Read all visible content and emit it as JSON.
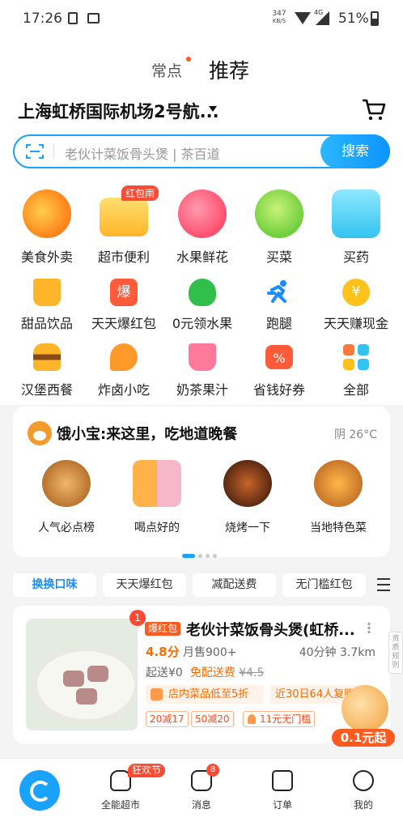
{
  "status_bar": {
    "time": "17:26",
    "speed_value": "347",
    "speed_unit": "KB/S",
    "network": "4G",
    "battery": "51%"
  },
  "header_tabs": {
    "frequent": "常点",
    "recommend": "推荐"
  },
  "location": {
    "text": "上海虹桥国际机场2号航..."
  },
  "search": {
    "placeholder": "老伙计菜饭骨头煲 | 茶百道",
    "button": "搜索"
  },
  "categories_primary": [
    {
      "label": "美食外卖",
      "icon": "food-delivery-icon"
    },
    {
      "label": "超市便利",
      "icon": "supermarket-basket-icon",
      "badge": "红包雨"
    },
    {
      "label": "水果鲜花",
      "icon": "fruit-icon"
    },
    {
      "label": "买菜",
      "icon": "vegetables-icon"
    },
    {
      "label": "买药",
      "icon": "medicine-box-icon"
    }
  ],
  "categories_secondary": [
    {
      "label": "甜品饮品",
      "icon": "drink-cup-icon"
    },
    {
      "label": "天天爆红包",
      "icon": "red-packet-icon",
      "glyph": "爆"
    },
    {
      "label": "0元领水果",
      "icon": "tree-icon"
    },
    {
      "label": "跑腿",
      "icon": "runner-icon"
    },
    {
      "label": "天天赚现金",
      "icon": "coin-icon",
      "glyph": "¥"
    },
    {
      "label": "汉堡西餐",
      "icon": "burger-icon"
    },
    {
      "label": "炸卤小吃",
      "icon": "drumstick-icon"
    },
    {
      "label": "奶茶果汁",
      "icon": "juice-icon"
    },
    {
      "label": "省钱好券",
      "icon": "coupon-icon",
      "glyph": "%"
    },
    {
      "label": "全部",
      "icon": "grid-all-icon"
    }
  ],
  "feature_card": {
    "brand": "饿小宝:",
    "title": "来这里，吃地道晚餐",
    "weather": "阴 26°C",
    "items": [
      {
        "label": "人气必点榜"
      },
      {
        "label": "喝点好的"
      },
      {
        "label": "烧烤一下"
      },
      {
        "label": "当地特色菜"
      }
    ]
  },
  "filter_chips": [
    "换换口味",
    "天天爆红包",
    "减配送费",
    "无门槛红包"
  ],
  "store": {
    "rank": "1",
    "tag": "爆红包",
    "name": "老伙计菜饭骨头煲(虹桥...",
    "score": "4.8分",
    "sold": "月售900+",
    "time_distance": "40分钟 3.7km",
    "min_order": "起送¥0",
    "free_delivery": "免配送费",
    "old_fee": "¥4.5",
    "promo_low_price": "店内菜品低至5折",
    "promo_recent": "近30日64人复购",
    "discount_tags": [
      "20减17",
      "50减20",
      "11元无门槛"
    ]
  },
  "side_label": "资质规则",
  "floater": {
    "label": "0.1元起"
  },
  "bottom_nav": {
    "market": "全能超市",
    "market_badge": "狂欢节",
    "messages": "消息",
    "messages_badge": "8",
    "orders": "订单",
    "me": "我的"
  },
  "colors": {
    "accent": "#1aa2ff",
    "orange": "#ff6a00",
    "red": "#ff4b33"
  }
}
